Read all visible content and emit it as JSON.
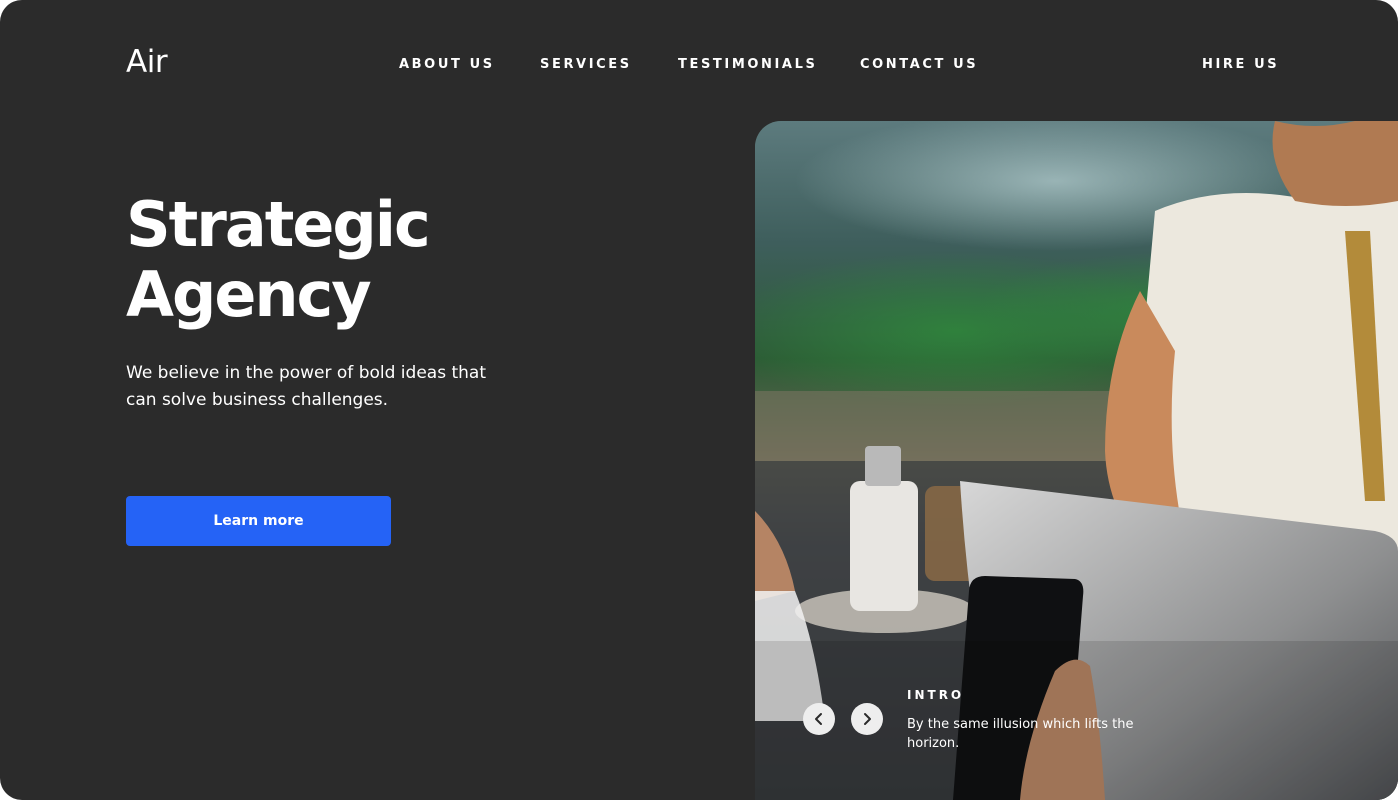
{
  "brand": {
    "logo_text": "Air"
  },
  "nav": {
    "items": [
      {
        "label": "ABOUT US"
      },
      {
        "label": "SERVICES"
      },
      {
        "label": "TESTIMONIALS"
      },
      {
        "label": "CONTACT US"
      }
    ],
    "hire_label": "HIRE US"
  },
  "hero": {
    "title_line1": "Strategic",
    "title_line2": "Agency",
    "description": "We believe in the power of bold ideas that can solve business challenges.",
    "cta_label": "Learn more"
  },
  "slider": {
    "label": "INTRO",
    "caption": "By the same illusion which lifts the horizon.",
    "prev_icon": "chevron-left-icon",
    "next_icon": "chevron-right-icon"
  },
  "colors": {
    "background": "#2b2b2b",
    "accent": "#2563f6",
    "text": "#ffffff"
  }
}
